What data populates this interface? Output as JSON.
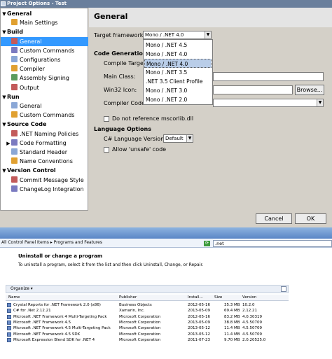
{
  "window": {
    "title": "Project Options - Test"
  },
  "tree": {
    "items": [
      {
        "label": "General",
        "type": "category",
        "expander": "▼"
      },
      {
        "label": "Main Settings",
        "type": "item"
      },
      {
        "label": "Build",
        "type": "category",
        "expander": "▼"
      },
      {
        "label": "General",
        "type": "item",
        "selected": true
      },
      {
        "label": "Custom Commands",
        "type": "item"
      },
      {
        "label": "Configurations",
        "type": "item"
      },
      {
        "label": "Compiler",
        "type": "item"
      },
      {
        "label": "Assembly Signing",
        "type": "item"
      },
      {
        "label": "Output",
        "type": "item"
      },
      {
        "label": "Run",
        "type": "category",
        "expander": "▼"
      },
      {
        "label": "General",
        "type": "item"
      },
      {
        "label": "Custom Commands",
        "type": "item"
      },
      {
        "label": "Source Code",
        "type": "category",
        "expander": "▼"
      },
      {
        "label": ".NET Naming Policies",
        "type": "item"
      },
      {
        "label": "Code Formatting",
        "type": "item",
        "expander": "▶"
      },
      {
        "label": "Standard Header",
        "type": "item"
      },
      {
        "label": "Name Conventions",
        "type": "item"
      },
      {
        "label": "Version Control",
        "type": "category",
        "expander": "▼"
      },
      {
        "label": "Commit Message Style",
        "type": "item"
      },
      {
        "label": "ChangeLog Integration",
        "type": "item"
      }
    ]
  },
  "panel": {
    "title": "General",
    "target_framework_label": "Target framework:",
    "target_framework_value": "Mono / .NET 4.0",
    "code_generation_header": "Code Generation",
    "compile_target_label": "Compile Target",
    "main_class_label": "Main Class:",
    "win32_icon_label": "Win32 Icon:",
    "browse_label": "Browse...",
    "compiler_code_label": "Compiler Code",
    "no_mscorlib_label": "Do not reference mscorlib.dll",
    "language_options_header": "Language Options",
    "csharp_version_label": "C# Language Version:",
    "csharp_version_value": "Default",
    "allow_unsafe_label": "Allow 'unsafe' code"
  },
  "dropdown": {
    "options": [
      "Mono / .NET 4.5",
      "Mono / .NET 4.0",
      "Mono / .NET 4.0",
      "Mono / .NET 3.5",
      ".NET 3.5 Client Profile",
      "Mono / .NET 3.0",
      "Mono / .NET 2.0"
    ],
    "selected_index": 2
  },
  "buttons": {
    "cancel": "Cancel",
    "ok": "OK"
  },
  "control_panel": {
    "address": "All Control Panel Items ▸ Programs and Features",
    "search_value": ".net",
    "heading": "Uninstall or change a program",
    "description": "To uninstall a program, select it from the list and then click Uninstall, Change, or Repair.",
    "organize_label": "Organize ▾",
    "columns": [
      "Name",
      "Publisher",
      "Install...",
      "Size",
      "Version"
    ],
    "rows": [
      [
        "Crystal Reports for .NET Framework 2.0 (x86)",
        "Business Objects",
        "2012-05-16",
        "35.3 MB",
        "10.2.0"
      ],
      [
        "C# for .Net 2.12.21",
        "Xamarin, Inc.",
        "2013-05-09",
        "69.4 MB",
        "2.12.21"
      ],
      [
        "Microsoft .NET Framework 4 Multi-Targeting Pack",
        "Microsoft Corporation",
        "2012-05-16",
        "83.2 MB",
        "4.0.30319"
      ],
      [
        "Microsoft .NET Framework 4.5",
        "Microsoft Corporation",
        "2013-05-09",
        "38.8 MB",
        "4.5.50709"
      ],
      [
        "Microsoft .NET Framework 4.5 Multi-Targeting Pack",
        "Microsoft Corporation",
        "2013-05-12",
        "11.4 MB",
        "4.5.50709"
      ],
      [
        "Microsoft .NET Framework 4.5 SDK",
        "Microsoft Corporation",
        "2013-05-12",
        "11.4 MB",
        "4.5.50709"
      ],
      [
        "Microsoft Expression Blend SDK for .NET 4",
        "Microsoft Corporation",
        "2011-07-23",
        "9.70 MB",
        "2.0.20525.0"
      ]
    ]
  },
  "colors": {
    "selection": "#3399ff",
    "titlebar": "#6a7f9c",
    "dialog_bg": "#d4d0c8"
  }
}
